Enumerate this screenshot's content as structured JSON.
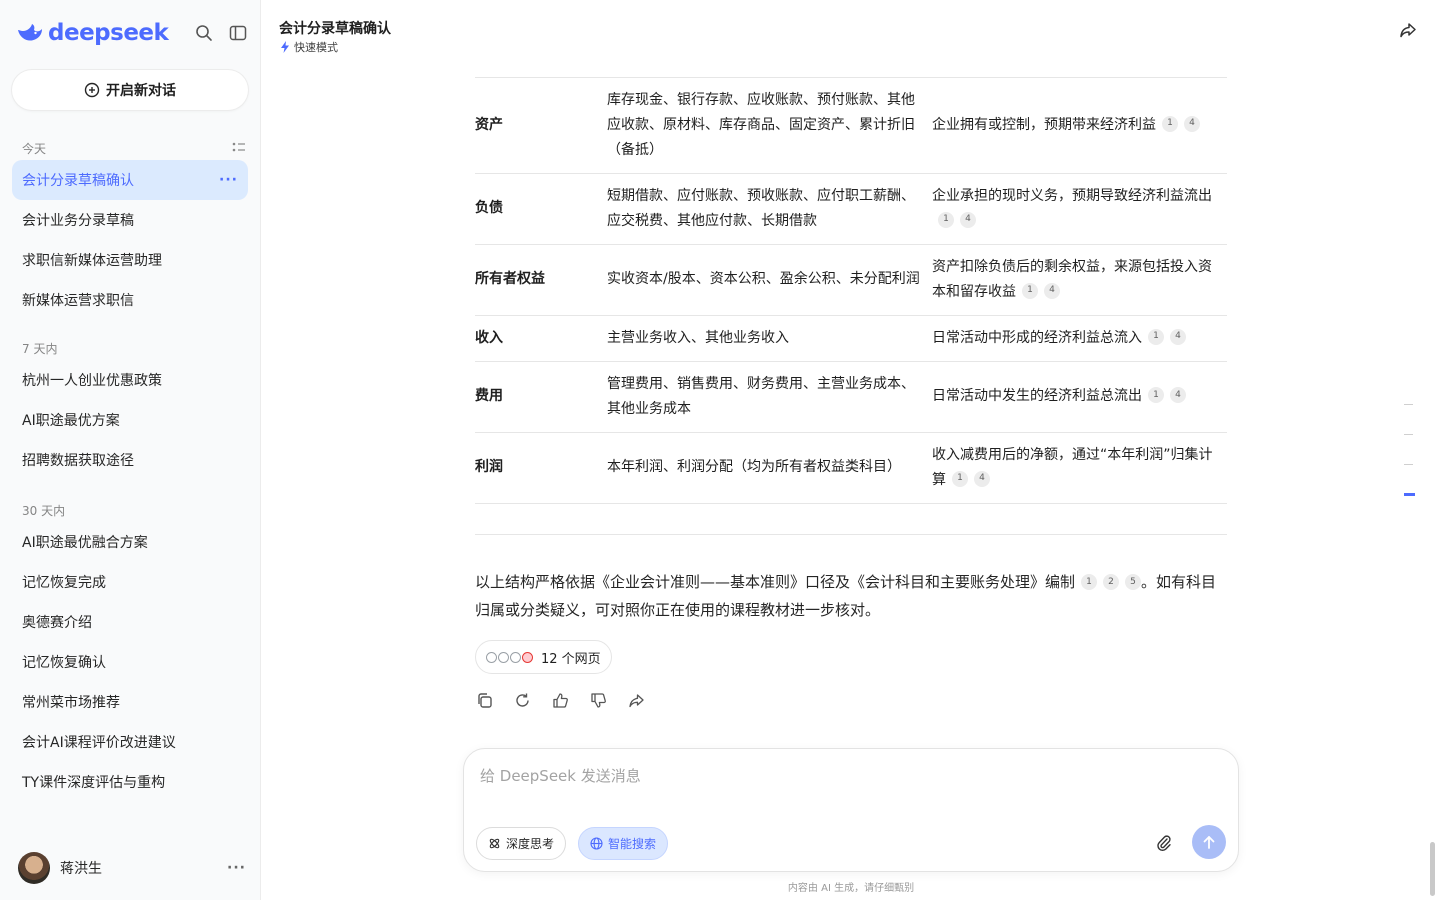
{
  "sidebar": {
    "brand": "deepseek",
    "new_chat": "开启新对话",
    "groups": [
      {
        "title": "今天",
        "items": [
          "会计分录草稿确认",
          "会计业务分录草稿",
          "求职信新媒体运营助理",
          "新媒体运营求职信"
        ]
      },
      {
        "title": "7 天内",
        "items": [
          "杭州一人创业优惠政策",
          "AI职途最优方案",
          "招聘数据获取途径"
        ]
      },
      {
        "title": "30 天内",
        "items": [
          "AI职途最优融合方案",
          "记忆恢复完成",
          "奥德赛介绍",
          "记忆恢复确认",
          "常州菜市场推荐",
          "会计AI课程评价改进建议",
          "TY课件深度评估与重构"
        ]
      }
    ],
    "active_item": "会计分录草稿确认",
    "user_name": "蒋洪生"
  },
  "header": {
    "title": "会计分录草稿确认",
    "mode": "快速模式"
  },
  "table": {
    "rows": [
      {
        "cat": "资产",
        "items": "库存现金、银行存款、应收账款、预付账款、其他应收款、原材料、库存商品、固定资产、累计折旧（备抵）",
        "desc": "企业拥有或控制，预期带来经济利益",
        "cites": [
          "1",
          "4"
        ]
      },
      {
        "cat": "负债",
        "items": "短期借款、应付账款、预收账款、应付职工薪酬、应交税费、其他应付款、长期借款",
        "desc": "企业承担的现时义务，预期导致经济利益流出",
        "cites": [
          "1",
          "4"
        ]
      },
      {
        "cat": "所有者权益",
        "items": "实收资本/股本、资本公积、盈余公积、未分配利润",
        "desc": "资产扣除负债后的剩余权益，来源包括投入资本和留存收益",
        "cites": [
          "1",
          "4"
        ]
      },
      {
        "cat": "收入",
        "items": "主营业务收入、其他业务收入",
        "desc": "日常活动中形成的经济利益总流入",
        "cites": [
          "1",
          "4"
        ]
      },
      {
        "cat": "费用",
        "items": "管理费用、销售费用、财务费用、主营业务成本、其他业务成本",
        "desc": "日常活动中发生的经济利益总流出",
        "cites": [
          "1",
          "4"
        ]
      },
      {
        "cat": "利润",
        "items": "本年利润、利润分配（均为所有者权益类科目）",
        "desc": "收入减费用后的净额，通过“本年利润”归集计算",
        "cites": [
          "1",
          "4"
        ]
      }
    ]
  },
  "summary": {
    "text_before": "以上结构严格依据《企业会计准则——基本准则》口径及《会计科目和主要账务处理》编制",
    "cites": [
      "1",
      "2",
      "5"
    ],
    "text_after": "。如有科目归属或分类疑义，可对照你正在使用的课程教材进一步核对。"
  },
  "sources": {
    "label": "12 个网页"
  },
  "composer": {
    "placeholder": "给 DeepSeek 发送消息",
    "deep_think": "深度思考",
    "smart_search": "智能搜索"
  },
  "disclaimer": "内容由 AI 生成，请仔细甄别",
  "colors": {
    "accent": "#4d6bfe",
    "active_bg": "#dbeafe"
  }
}
